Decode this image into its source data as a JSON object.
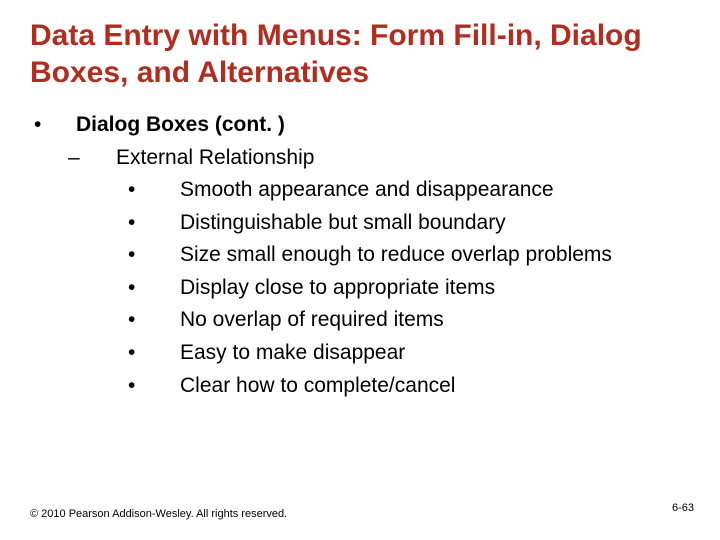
{
  "title": "Data Entry with Menus: Form Fill-in, Dialog Boxes, and Alternatives",
  "lvl1": {
    "label": "Dialog Boxes (cont. )"
  },
  "lvl2": {
    "label": "External Relationship"
  },
  "bullets": [
    "Smooth appearance and disappearance",
    "Distinguishable but small boundary",
    "Size small enough to reduce overlap problems",
    "Display close to appropriate items",
    "No overlap of required items",
    "Easy to make disappear",
    "Clear how to complete/cancel"
  ],
  "footer": {
    "copyright": "© 2010 Pearson Addison-Wesley. All rights reserved.",
    "page": "6-63"
  }
}
